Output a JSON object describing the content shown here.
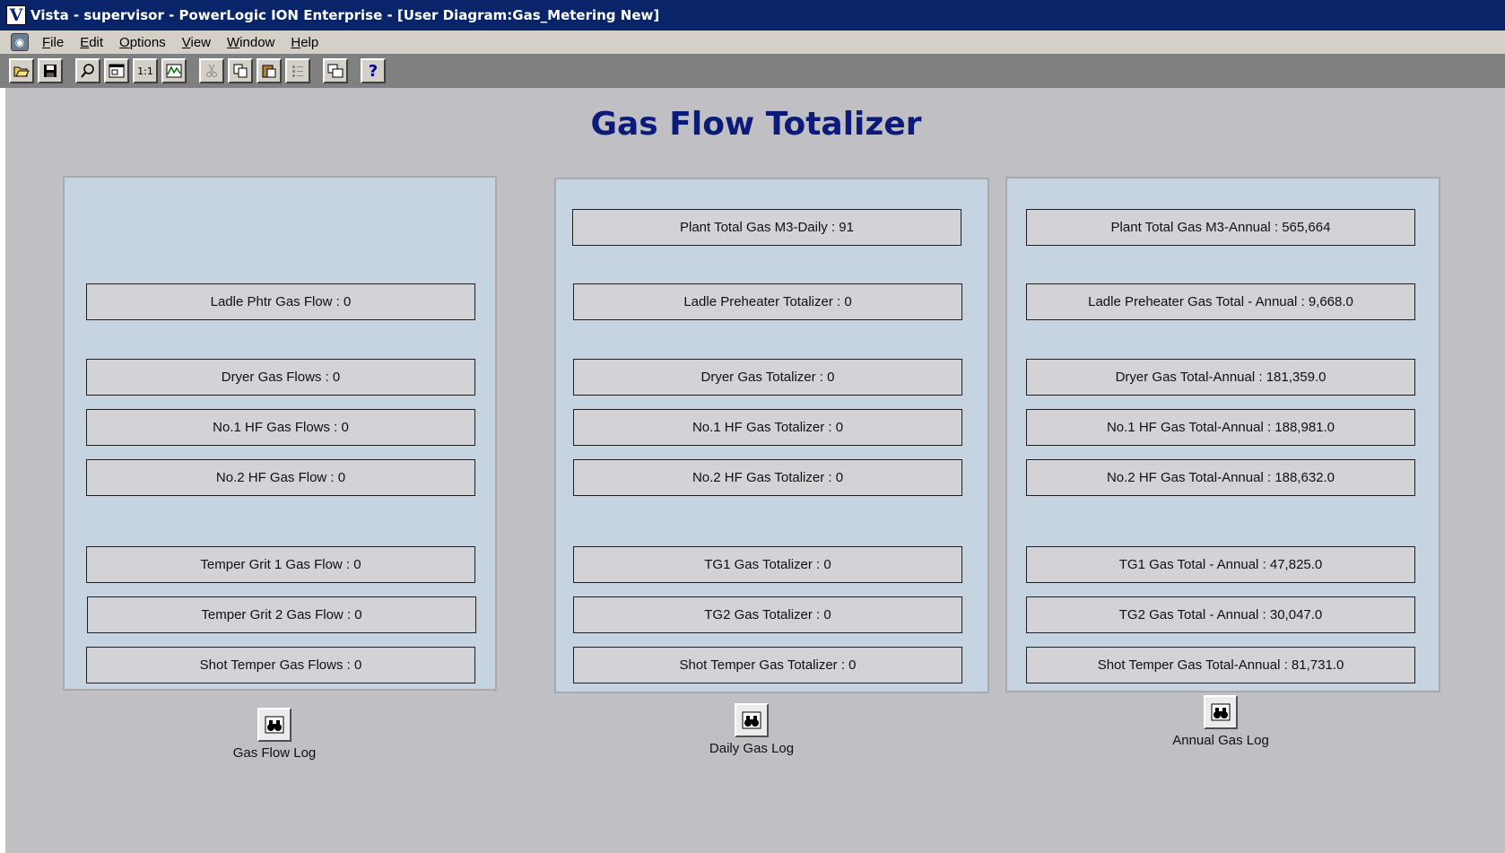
{
  "window": {
    "title": "Vista - supervisor - PowerLogic ION Enterprise - [User Diagram:Gas_Metering New]",
    "app_icon_glyph": "V"
  },
  "menu": [
    {
      "label": "File",
      "key": "F",
      "rest": "ile"
    },
    {
      "label": "Edit",
      "key": "E",
      "rest": "dit"
    },
    {
      "label": "Options",
      "key": "O",
      "rest": "ptions"
    },
    {
      "label": "View",
      "key": "V",
      "rest": "iew"
    },
    {
      "label": "Window",
      "key": "W",
      "rest": "indow"
    },
    {
      "label": "Help",
      "key": "H",
      "rest": "elp"
    }
  ],
  "toolbar": {
    "open": "open-folder-icon",
    "save": "save-disk-icon",
    "find": "magnifier-icon",
    "fit": "fit-window-icon",
    "actual_size_glyph": "1:1",
    "chart": "chart-icon",
    "cut": "cut-icon",
    "copy": "copy-icon",
    "paste": "paste-icon",
    "properties": "properties-icon",
    "window_switch": "window-switch-icon",
    "help_glyph": "?"
  },
  "diagram": {
    "title": "Gas Flow Totalizer",
    "colors": {
      "title": "#0c1b7a",
      "panel": "#c6d3e0",
      "field": "#d3d2d6"
    },
    "flow_panel": {
      "fields": [
        "Ladle Phtr Gas Flow : 0",
        "Dryer Gas Flows : 0",
        "No.1 HF Gas Flows : 0",
        "No.2 HF Gas Flow : 0",
        "Temper Grit 1 Gas Flow : 0",
        "Temper Grit 2 Gas Flow : 0",
        "Shot Temper Gas Flows : 0"
      ],
      "log_label": "Gas Flow Log"
    },
    "daily_panel": {
      "fields": [
        "Plant Total Gas M3-Daily : 91",
        "Ladle Preheater Totalizer : 0",
        "Dryer Gas Totalizer : 0",
        "No.1 HF Gas Totalizer : 0",
        "No.2 HF Gas Totalizer : 0",
        "TG1 Gas Totalizer : 0",
        "TG2 Gas Totalizer : 0",
        "Shot Temper Gas Totalizer : 0"
      ],
      "log_label": "Daily Gas Log"
    },
    "annual_panel": {
      "fields": [
        "Plant Total Gas M3-Annual : 565,664",
        "Ladle Preheater  Gas Total - Annual : 9,668.0",
        "Dryer Gas Total-Annual : 181,359.0",
        "No.1 HF Gas Total-Annual : 188,981.0",
        "No.2 HF Gas Total-Annual : 188,632.0",
        "TG1  Gas Total - Annual : 47,825.0",
        "TG2  Gas Total - Annual : 30,047.0",
        "Shot Temper Gas Total-Annual : 81,731.0"
      ],
      "log_label": "Annual Gas Log"
    }
  }
}
